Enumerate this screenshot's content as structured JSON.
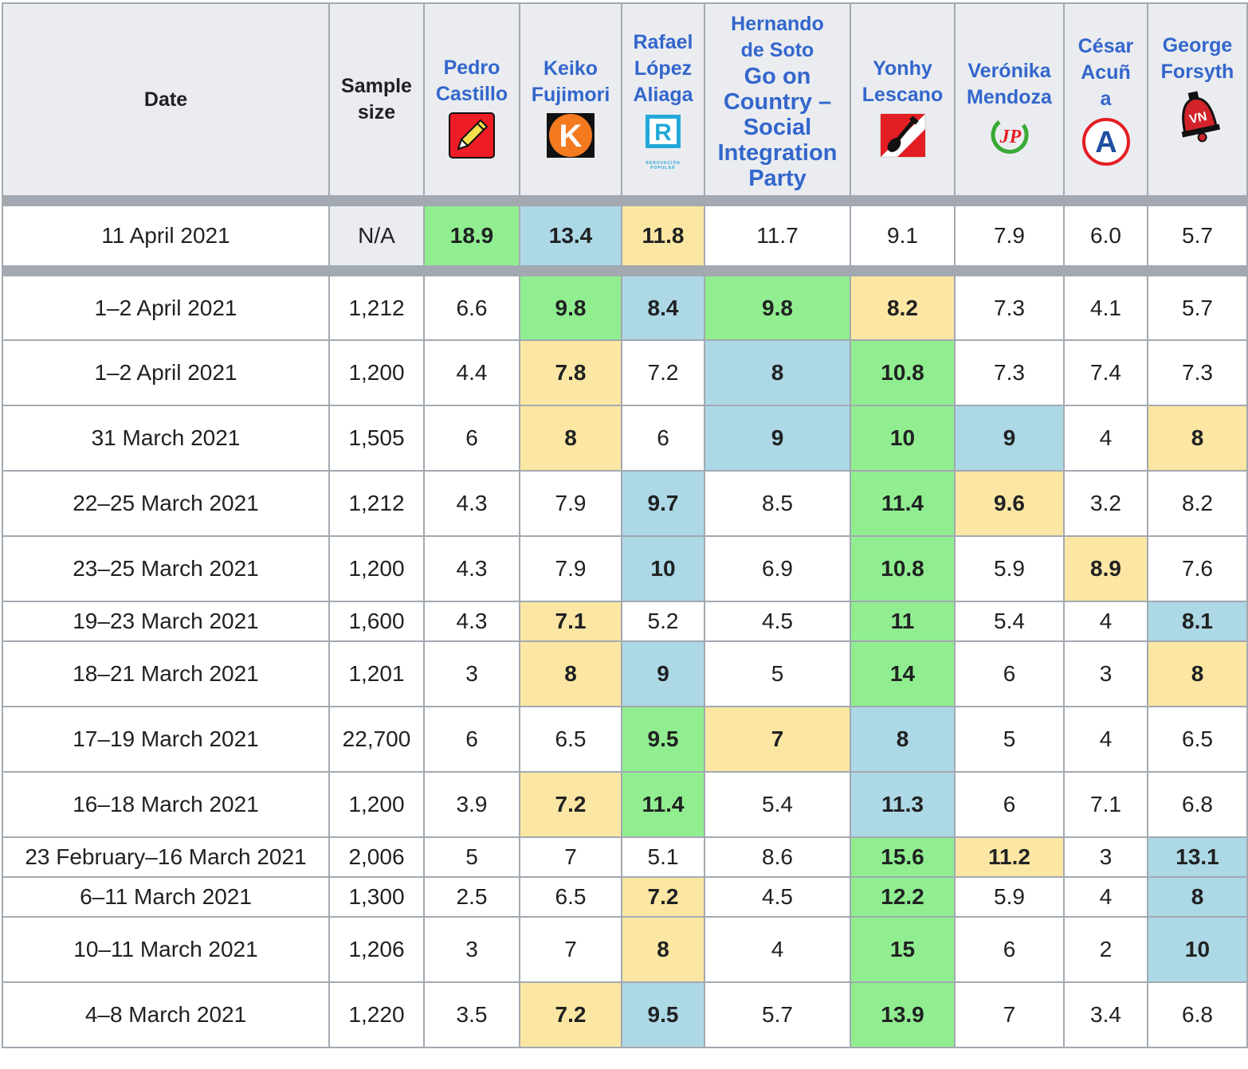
{
  "header": {
    "date": "Date",
    "sample_size": "Sample size",
    "candidates": [
      {
        "name_line1": "Pedro",
        "name_line2": "Castillo",
        "logo": "pencil-icon"
      },
      {
        "name_line1": "Keiko",
        "name_line2": "Fujimori",
        "logo": "k-logo-icon"
      },
      {
        "name_line1": "Rafael",
        "name_line2": "López",
        "name_line3": "Aliaga",
        "logo": "r-logo-icon",
        "logo_text": "RENOVACIÓN POPULAR"
      },
      {
        "name_line1": "Hernando",
        "name_line2": "de Soto",
        "party": "Go on Country – Social Integration Party"
      },
      {
        "name_line1": "Yonhy",
        "name_line2": "Lescano",
        "logo": "shovel-icon"
      },
      {
        "name_line1": "Verónika",
        "name_line2": "Mendoza",
        "logo": "jp-logo-icon",
        "logo_text": "JP"
      },
      {
        "name_line1": "César",
        "name_line2": "Acuñ",
        "name_line3": "a",
        "logo": "a-logo-icon",
        "logo_text": "A"
      },
      {
        "name_line1": "George",
        "name_line2": "Forsyth",
        "logo": "bell-icon",
        "logo_text": "VN"
      }
    ]
  },
  "result_row": {
    "date": "11 April 2021",
    "sample": "N/A",
    "values": [
      "18.9",
      "13.4",
      "11.8",
      "11.7",
      "9.1",
      "7.9",
      "6.0",
      "5.7"
    ]
  },
  "rows": [
    {
      "date": "1–2 April 2021",
      "sample": "1,212",
      "values": [
        "6.6",
        "9.8",
        "8.4",
        "9.8",
        "8.2",
        "7.3",
        "4.1",
        "5.7"
      ]
    },
    {
      "date": "1–2 April 2021",
      "sample": "1,200",
      "values": [
        "4.4",
        "7.8",
        "7.2",
        "8",
        "10.8",
        "7.3",
        "7.4",
        "7.3"
      ]
    },
    {
      "date": "31 March 2021",
      "sample": "1,505",
      "values": [
        "6",
        "8",
        "6",
        "9",
        "10",
        "9",
        "4",
        "8"
      ]
    },
    {
      "date": "22–25 March 2021",
      "sample": "1,212",
      "values": [
        "4.3",
        "7.9",
        "9.7",
        "8.5",
        "11.4",
        "9.6",
        "3.2",
        "8.2"
      ]
    },
    {
      "date": "23–25 March 2021",
      "sample": "1,200",
      "values": [
        "4.3",
        "7.9",
        "10",
        "6.9",
        "10.8",
        "5.9",
        "8.9",
        "7.6"
      ]
    },
    {
      "date": "19–23 March 2021",
      "sample": "1,600",
      "values": [
        "4.3",
        "7.1",
        "5.2",
        "4.5",
        "11",
        "5.4",
        "4",
        "8.1"
      ]
    },
    {
      "date": "18–21 March 2021",
      "sample": "1,201",
      "values": [
        "3",
        "8",
        "9",
        "5",
        "14",
        "6",
        "3",
        "8"
      ]
    },
    {
      "date": "17–19 March 2021",
      "sample": "22,700",
      "values": [
        "6",
        "6.5",
        "9.5",
        "7",
        "8",
        "5",
        "4",
        "6.5"
      ]
    },
    {
      "date": "16–18 March 2021",
      "sample": "1,200",
      "values": [
        "3.9",
        "7.2",
        "11.4",
        "5.4",
        "11.3",
        "6",
        "7.1",
        "6.8"
      ]
    },
    {
      "date": "23 February–16 March 2021",
      "sample": "2,006",
      "values": [
        "5",
        "7",
        "5.1",
        "8.6",
        "15.6",
        "11.2",
        "3",
        "13.1"
      ]
    },
    {
      "date": "6–11 March 2021",
      "sample": "1,300",
      "values": [
        "2.5",
        "6.5",
        "7.2",
        "4.5",
        "12.2",
        "5.9",
        "4",
        "8"
      ]
    },
    {
      "date": "10–11 March 2021",
      "sample": "1,206",
      "values": [
        "3",
        "7",
        "8",
        "4",
        "15",
        "6",
        "2",
        "10"
      ]
    },
    {
      "date": "4–8 March 2021",
      "sample": "1,220",
      "values": [
        "3.5",
        "7.2",
        "9.5",
        "5.7",
        "13.9",
        "7",
        "3.4",
        "6.8"
      ]
    }
  ]
}
